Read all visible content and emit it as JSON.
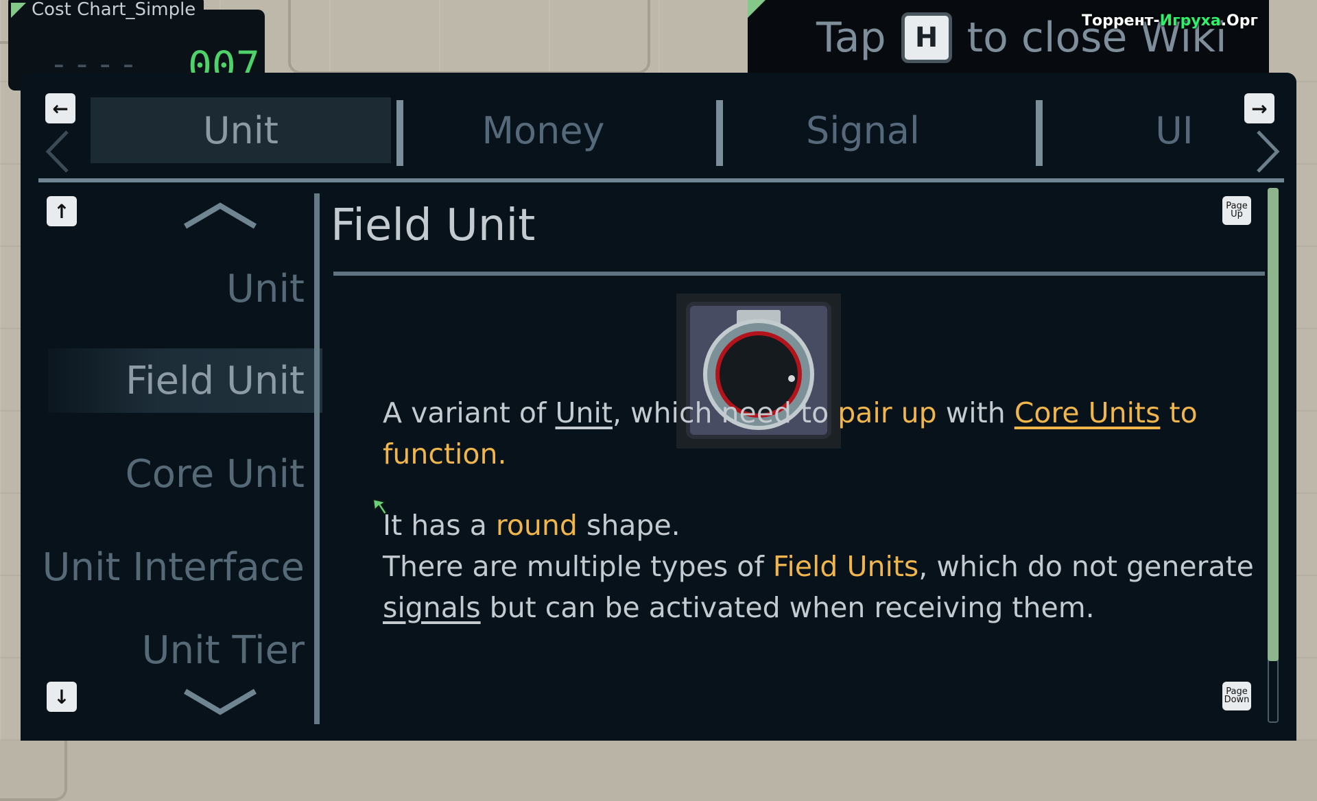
{
  "chart_header": {
    "title": "Cost Chart_Simple",
    "dashes": "----",
    "count": "007"
  },
  "hint": {
    "tap": "Tap",
    "key": "H",
    "rest": "to close Wiki"
  },
  "watermark": {
    "part1": "Торрент-",
    "part2": "Игруха",
    "part3": ".Орг"
  },
  "tabs": [
    {
      "label": "Unit",
      "active": true
    },
    {
      "label": "Money",
      "active": false
    },
    {
      "label": "Signal",
      "active": false
    },
    {
      "label": "UI",
      "active": false
    }
  ],
  "nav": {
    "prev_tab_icon": "arrow-left-icon",
    "next_tab_icon": "arrow-right-icon",
    "up_icon": "arrow-up-icon",
    "down_icon": "arrow-down-icon",
    "page_up": "Page Up",
    "page_down": "Page Down"
  },
  "sidebar": {
    "items": [
      {
        "label": "Unit",
        "active": false
      },
      {
        "label": "Field Unit",
        "active": true
      },
      {
        "label": "Core Unit",
        "active": false
      },
      {
        "label": "Unit Interface",
        "active": false
      },
      {
        "label": "Unit Tier",
        "active": false
      }
    ]
  },
  "article": {
    "title": "Field Unit",
    "icon": "round-field-unit-icon",
    "p1": {
      "a": "A variant of ",
      "link1": "Unit",
      "b": ", which need to ",
      "hl1": "pair up",
      "c": " with ",
      "link2": "Core Units",
      "hl2": " to function."
    },
    "p2": {
      "a": "It has a ",
      "hl": "round",
      "b": " shape."
    },
    "p3": {
      "a": "There are multiple types of ",
      "hl": "Field Units",
      "b": ", which do not generate ",
      "link": "signals",
      "c": " but can be activated when receiving them."
    }
  },
  "colors": {
    "accent_green": "#84c98a",
    "highlight": "#f0b54b",
    "counter": "#4ed36b",
    "panel": "#07121a"
  }
}
